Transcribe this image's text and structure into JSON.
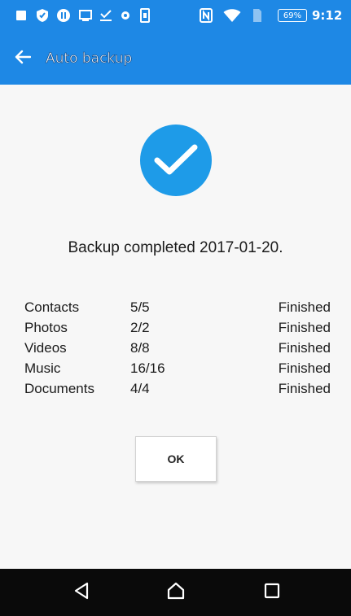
{
  "status_bar": {
    "battery_percent": "69%",
    "time": "9:12",
    "icons": [
      "notification-square-icon",
      "shield-icon",
      "sync-icon",
      "screen-icon",
      "download-icon",
      "dot-icon",
      "phone-icon",
      "nfc-icon",
      "wifi-icon",
      "sim-icon",
      "battery-icon"
    ]
  },
  "app_bar": {
    "title": "Auto backup",
    "back_icon": "arrow-left-icon"
  },
  "content": {
    "status_icon": "check-circle-icon",
    "summary": "Backup completed 2017-01-20.",
    "results": [
      {
        "category": "Contacts",
        "count": "5/5",
        "status": "Finished"
      },
      {
        "category": "Photos",
        "count": "2/2",
        "status": "Finished"
      },
      {
        "category": "Videos",
        "count": "8/8",
        "status": "Finished"
      },
      {
        "category": "Music",
        "count": "16/16",
        "status": "Finished"
      },
      {
        "category": "Documents",
        "count": "4/4",
        "status": "Finished"
      }
    ],
    "ok_label": "OK"
  },
  "nav_bar": {
    "icons": [
      "back-triangle-icon",
      "home-icon",
      "recents-icon"
    ]
  },
  "colors": {
    "primary": "#1e88e5",
    "check": "#1e9be8",
    "nav": "#0a0a0a",
    "background": "#f7f7f7"
  }
}
